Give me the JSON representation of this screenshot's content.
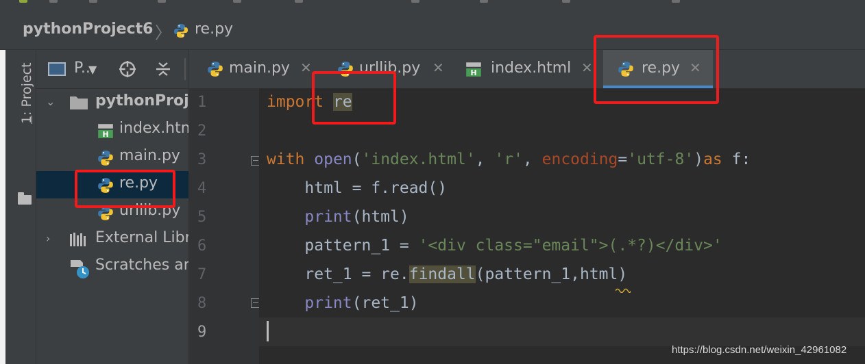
{
  "breadcrumb": {
    "project": "pythonProject6",
    "file": "re.py"
  },
  "tool_stripe": {
    "project_label_num": "1",
    "project_label_text": ": Project"
  },
  "project_panel": {
    "pane_label": "P..",
    "tree": [
      {
        "label": "pythonProj",
        "type": "folder",
        "expanded": true
      },
      {
        "label": "index.htm",
        "type": "html"
      },
      {
        "label": "main.py",
        "type": "python"
      },
      {
        "label": "re.py",
        "type": "python",
        "selected": true
      },
      {
        "label": "urllib.py",
        "type": "python"
      },
      {
        "label": "External Libr",
        "type": "library",
        "expanded": false
      },
      {
        "label": "Scratches ar",
        "type": "scratches"
      }
    ]
  },
  "tabs": [
    {
      "label": "main.py",
      "type": "python"
    },
    {
      "label": "urllib.py",
      "type": "python"
    },
    {
      "label": "index.html",
      "type": "html"
    },
    {
      "label": "re.py",
      "type": "python",
      "active": true
    }
  ],
  "editor": {
    "line_numbers": [
      "1",
      "2",
      "3",
      "4",
      "5",
      "6",
      "7",
      "8",
      "9"
    ],
    "current_line": "9",
    "code": {
      "l1_kw": "import",
      "l1_mod": "re",
      "l3_with": "with",
      "l3_open": "open",
      "l3_p1": "(",
      "l3_s1": "'index.html'",
      "l3_c1": ", ",
      "l3_s2": "'r'",
      "l3_c2": ", ",
      "l3_enc": "encoding",
      "l3_eq": "=",
      "l3_s3": "'utf-8'",
      "l3_close": ")",
      "l3_as": "as",
      "l3_f": " f:",
      "l4": "    html = f.read()",
      "l5_print": "print",
      "l5_rest": "(html)",
      "l6_lhs": "    pattern_1 = ",
      "l6_str": "'<div class=\"email\">(.*?)</div>'",
      "l7_lhs": "    ret_1 = re.",
      "l7_fn": "findall",
      "l7_rest": "(pattern_1,html)",
      "l8_print": "print",
      "l8_rest": "(ret_1)"
    }
  },
  "watermark": "https://blog.csdn.net/weixin_42961082",
  "colors": {
    "keyword": "#cc7832",
    "builtin": "#8888c6",
    "string": "#6a8759",
    "param": "#aa4926",
    "annotation": "#ee1c1c",
    "tab_underline": "#4a88c7",
    "selection": "#0d293e"
  }
}
